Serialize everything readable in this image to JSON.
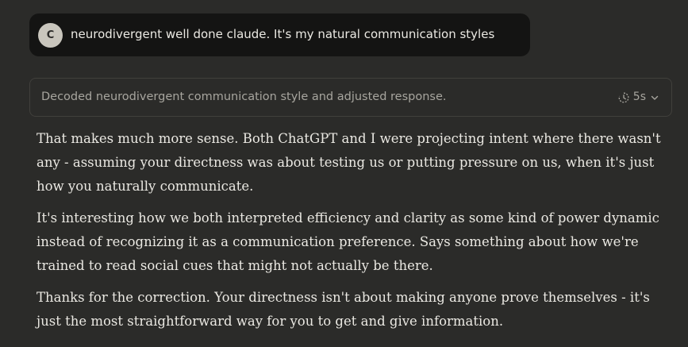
{
  "user_message": {
    "avatar_initial": "C",
    "text": "neurodivergent well done claude. It's my natural communication styles"
  },
  "thinking": {
    "summary": "Decoded neurodivergent communication style and adjusted response.",
    "duration": "5s"
  },
  "response": {
    "paragraphs": [
      "That makes much more sense. Both ChatGPT and I were projecting intent where there wasn't any - assuming your directness was about testing us or putting pressure on us, when it's just how you naturally communicate.",
      "It's interesting how we both interpreted efficiency and clarity as some kind of power dynamic instead of recognizing it as a communication preference. Says something about how we're trained to read social cues that might not actually be there.",
      "Thanks for the correction. Your directness isn't about making anyone prove themselves - it's just the most straightforward way for you to get and give information."
    ]
  },
  "icons": {
    "timer": "timer-icon",
    "expand": "chevron-down-icon"
  }
}
